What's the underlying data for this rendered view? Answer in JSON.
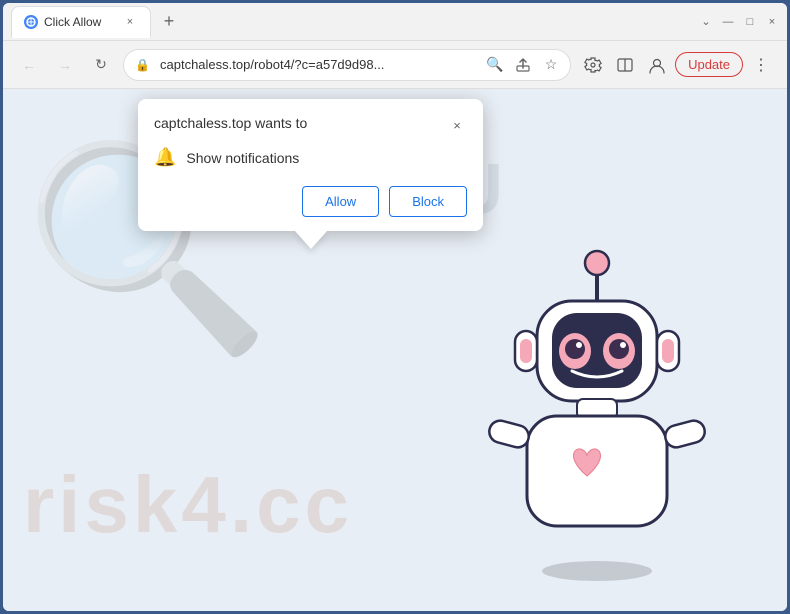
{
  "window": {
    "title": "Click Allow",
    "tab_label": "Click Allow",
    "close_label": "×",
    "new_tab_label": "+",
    "minimize_label": "—",
    "maximize_label": "□",
    "winclose_label": "×"
  },
  "address_bar": {
    "url": "captchaless.top/robot4/?c=a57d9d98...",
    "lock_icon": "🔒",
    "update_label": "Update"
  },
  "popup": {
    "title": "captchaless.top wants to",
    "close_label": "×",
    "notification_text": "Show notifications",
    "allow_label": "Allow",
    "block_label": "Block"
  },
  "background": {
    "you_text": "OU",
    "watermark": "risk4.cc"
  },
  "icons": {
    "back": "←",
    "forward": "→",
    "reload": "↻",
    "search": "🔍",
    "share": "↑",
    "star": "☆",
    "puzzle": "🧩",
    "extensions": "⊟",
    "profile": "👤",
    "menu": "⋮",
    "bell": "🔔"
  }
}
